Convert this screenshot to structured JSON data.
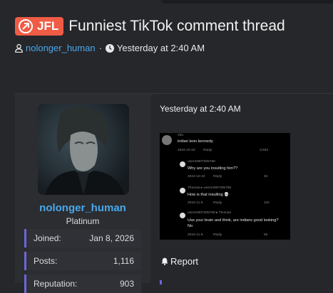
{
  "thread": {
    "prefix": "JFL",
    "title": "Funniest TikTok comment thread",
    "author": "nolonger_human",
    "separator": "·",
    "date": "Yesterday at 2:40 AM"
  },
  "post": {
    "username": "nolonger_human",
    "rank": "Platinum",
    "stats": [
      {
        "label": "Joined:",
        "value": "Jan 8, 2026"
      },
      {
        "label": "Posts:",
        "value": "1,116"
      },
      {
        "label": "Reputation:",
        "value": "903"
      }
    ],
    "date": "Yesterday at 2:40 AM",
    "report_label": "Report"
  },
  "screenshot": {
    "comments": [
      {
        "user": "Vito",
        "text": "indian leon kennedy",
        "date": "2024-10-23",
        "reply": "Reply",
        "likes": "3,933"
      },
      {
        "user": "user24907305759",
        "text": "Why are you insulting him??",
        "date": "2024-10-24",
        "reply": "Reply",
        "likes": "63"
      },
      {
        "user": "Thomas ▸ user24907305759",
        "text": "How is that insulting 💀",
        "date": "2024-11-9",
        "reply": "Reply",
        "likes": "115"
      },
      {
        "user": "user24907305759 ▸ Thomas",
        "text": "Use your brain and think, are indians good looking? No",
        "date": "2024-11-9",
        "reply": "Reply",
        "likes": "55"
      }
    ]
  },
  "colors": {
    "badge": "#f05b45",
    "link": "#4aa8ea",
    "stat_accent": "#6b66d9"
  },
  "icons": {
    "prefix": "fire-badge-icon",
    "author": "user-icon",
    "date": "clock-icon",
    "report": "bell-icon"
  }
}
